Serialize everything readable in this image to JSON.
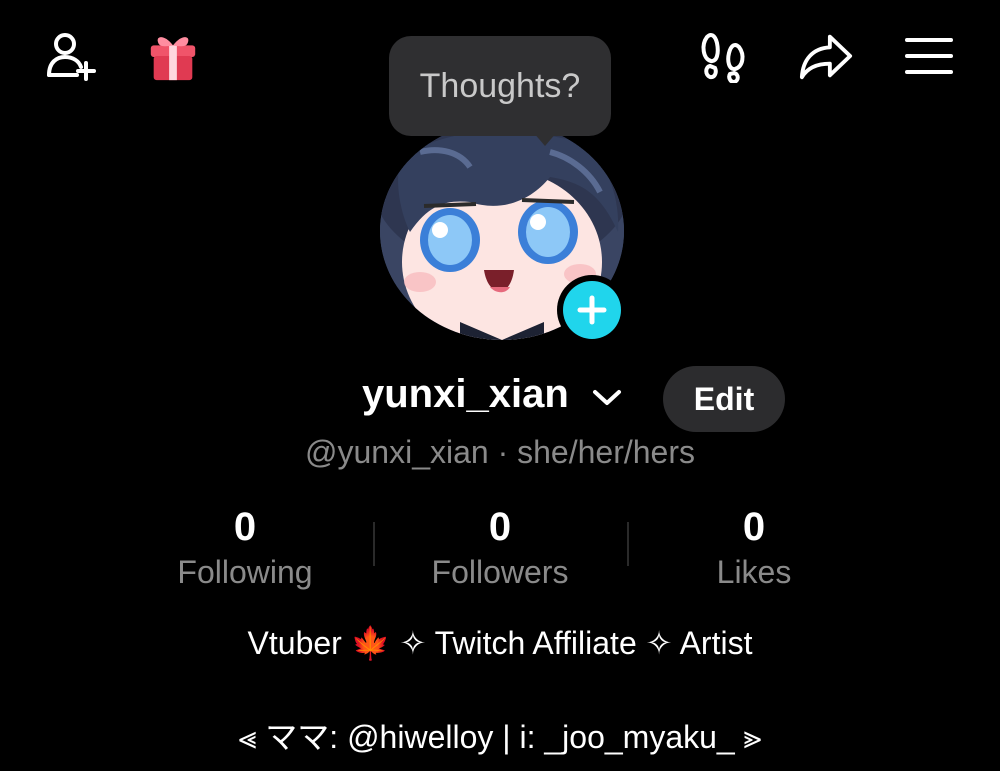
{
  "tooltip": {
    "text": "Thoughts?"
  },
  "profile": {
    "username": "yunxi_xian",
    "edit_label": "Edit",
    "handle": "@yunxi_xian",
    "separator": "·",
    "pronouns": "she/her/hers"
  },
  "stats": [
    {
      "value": "0",
      "label": "Following"
    },
    {
      "value": "0",
      "label": "Followers"
    },
    {
      "value": "0",
      "label": "Likes"
    }
  ],
  "bio": {
    "line1": "Vtuber 🍁 ✧ Twitch Affiliate ✧ Artist",
    "line2": "⪡ ママ: @hiwelloy | i: _joo_myaku_ ⪢"
  },
  "colors": {
    "accent": "#20d5ec",
    "muted_text": "#8a8a8a",
    "button_bg": "#2c2c2e"
  },
  "icons": {
    "add_friend": "add-friend-icon",
    "gift": "gift-icon",
    "footprints": "footprints-icon",
    "share": "share-icon",
    "menu": "menu-icon"
  }
}
